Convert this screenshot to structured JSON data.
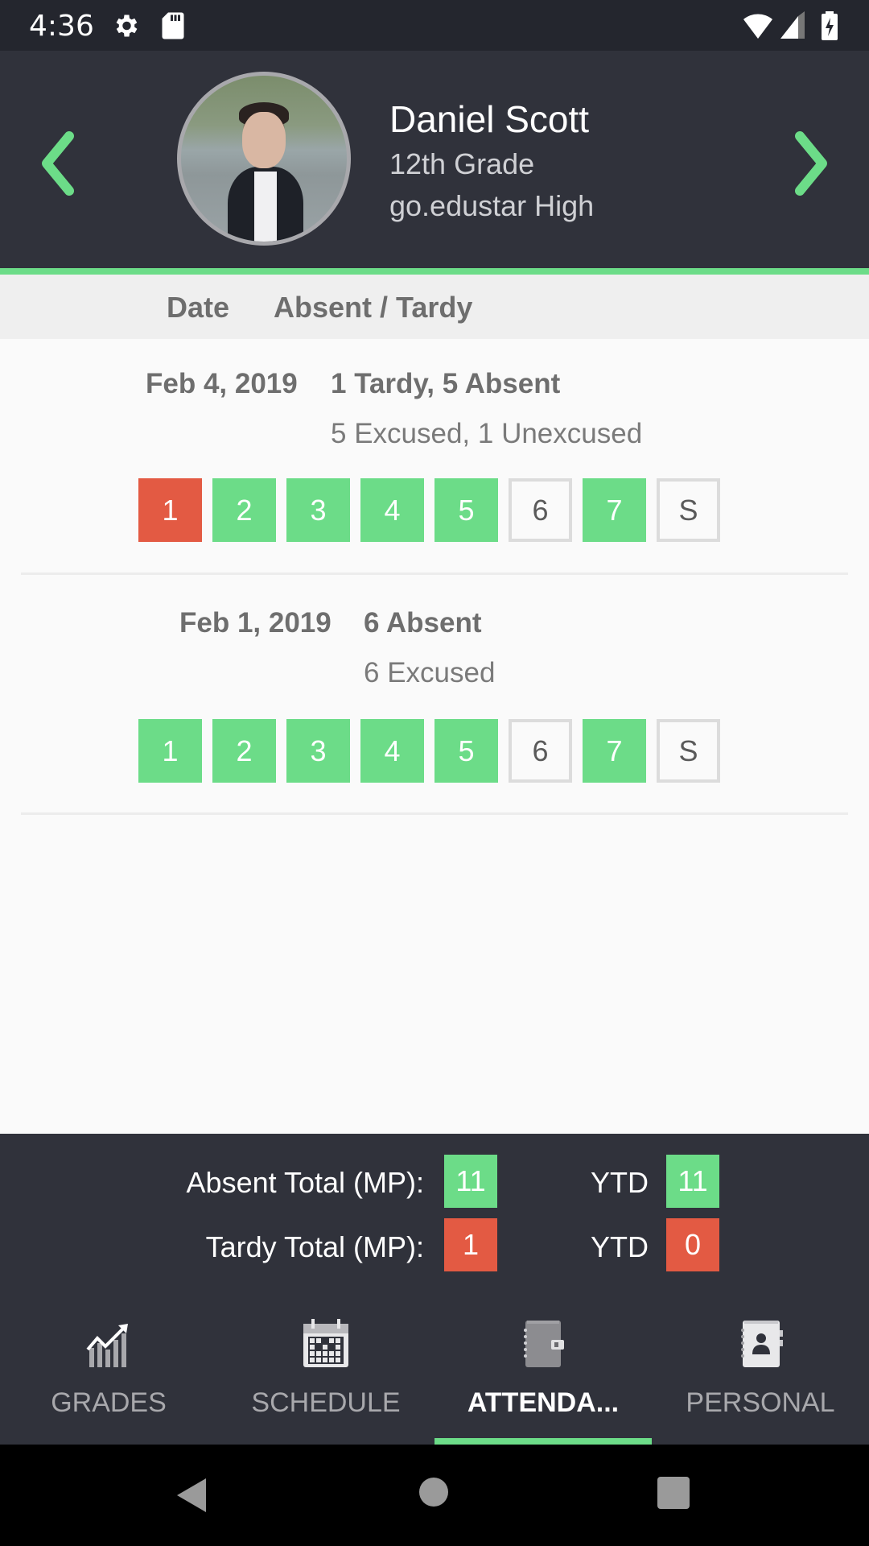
{
  "status_bar": {
    "time": "4:36",
    "icons": [
      "gear-icon",
      "sd-card-icon",
      "wifi-icon",
      "cell-signal-icon",
      "battery-charging-icon"
    ]
  },
  "header": {
    "student_name": "Daniel Scott",
    "grade": "12th Grade",
    "school": "go.edustar High",
    "prev_icon": "chevron-left-icon",
    "next_icon": "chevron-right-icon"
  },
  "columns": {
    "date": "Date",
    "absent_tardy": "Absent / Tardy"
  },
  "records": [
    {
      "date": "Feb 4, 2019",
      "summary": "1 Tardy, 5 Absent",
      "detail": "5 Excused, 1 Unexcused",
      "periods": [
        {
          "label": "1",
          "status": "tardy"
        },
        {
          "label": "2",
          "status": "present"
        },
        {
          "label": "3",
          "status": "present"
        },
        {
          "label": "4",
          "status": "present"
        },
        {
          "label": "5",
          "status": "present"
        },
        {
          "label": "6",
          "status": "none"
        },
        {
          "label": "7",
          "status": "present"
        },
        {
          "label": "S",
          "status": "none"
        }
      ]
    },
    {
      "date": "Feb 1, 2019",
      "summary": "6 Absent",
      "detail": "6 Excused",
      "periods": [
        {
          "label": "1",
          "status": "present"
        },
        {
          "label": "2",
          "status": "present"
        },
        {
          "label": "3",
          "status": "present"
        },
        {
          "label": "4",
          "status": "present"
        },
        {
          "label": "5",
          "status": "present"
        },
        {
          "label": "6",
          "status": "none"
        },
        {
          "label": "7",
          "status": "present"
        },
        {
          "label": "S",
          "status": "none"
        }
      ]
    }
  ],
  "totals": {
    "absent_label": "Absent Total (MP):",
    "absent_mp": "11",
    "absent_ytd_label": "YTD",
    "absent_ytd": "11",
    "tardy_label": "Tardy Total (MP):",
    "tardy_mp": "1",
    "tardy_ytd_label": "YTD",
    "tardy_ytd": "0"
  },
  "tabs": [
    {
      "label": "GRADES",
      "icon": "chart-icon",
      "active": false
    },
    {
      "label": "SCHEDULE",
      "icon": "calendar-icon",
      "active": false
    },
    {
      "label": "ATTENDA...",
      "icon": "planner-icon",
      "active": true
    },
    {
      "label": "PERSONAL",
      "icon": "contact-book-icon",
      "active": false
    }
  ],
  "colors": {
    "accent_green": "#6cdc88",
    "alert_red": "#e35a43",
    "header_bg": "#30323b"
  }
}
